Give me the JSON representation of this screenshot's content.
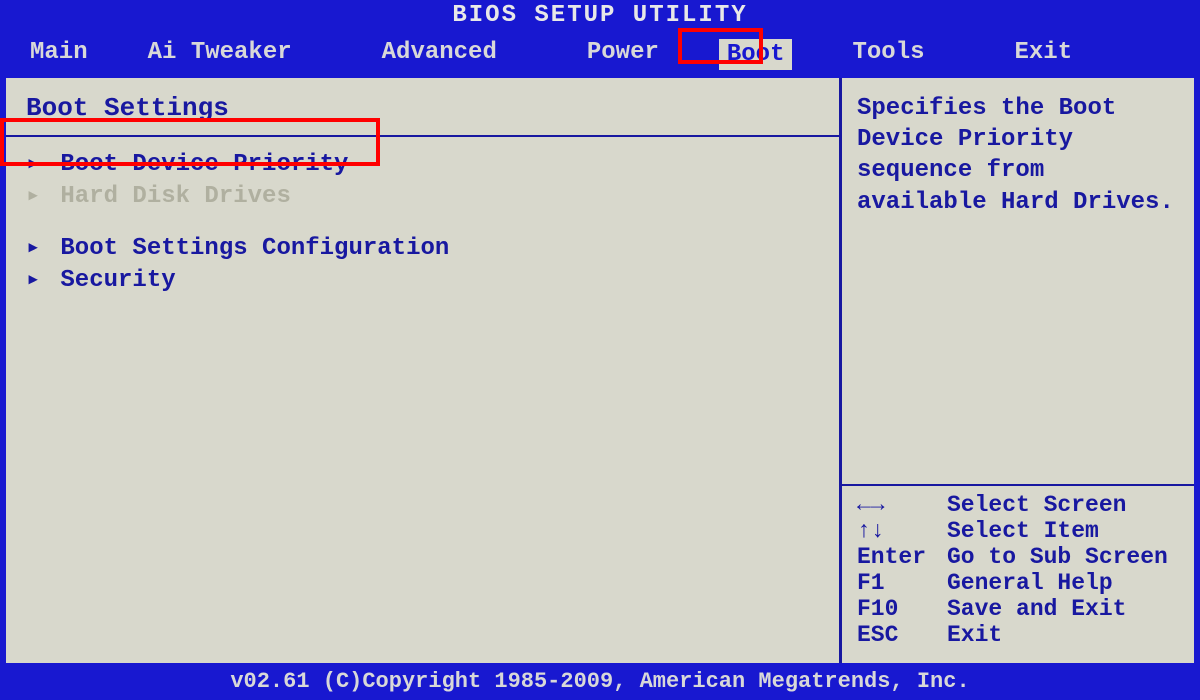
{
  "title": "BIOS SETUP UTILITY",
  "menu": {
    "items": [
      {
        "label": "Main"
      },
      {
        "label": "Ai Tweaker"
      },
      {
        "label": "Advanced"
      },
      {
        "label": "Power"
      },
      {
        "label": "Boot"
      },
      {
        "label": "Tools"
      },
      {
        "label": "Exit"
      }
    ],
    "selected": "Boot"
  },
  "section_header": "Boot Settings",
  "options": [
    {
      "label": "Boot Device Priority",
      "dimmed": false
    },
    {
      "label": "Hard Disk Drives",
      "dimmed": true
    },
    {
      "label": "Boot Settings Configuration",
      "dimmed": false
    },
    {
      "label": "Security",
      "dimmed": false
    }
  ],
  "help_text": "Specifies the Boot Device Priority sequence from available Hard Drives.",
  "key_hints": [
    {
      "key": "←→",
      "action": "Select Screen"
    },
    {
      "key": "↑↓",
      "action": "Select Item"
    },
    {
      "key": "Enter",
      "action": "Go to Sub Screen"
    },
    {
      "key": "F1",
      "action": "General Help"
    },
    {
      "key": "F10",
      "action": "Save and Exit"
    },
    {
      "key": "ESC",
      "action": "Exit"
    }
  ],
  "footer": "v02.61 (C)Copyright 1985-2009, American Megatrends, Inc."
}
